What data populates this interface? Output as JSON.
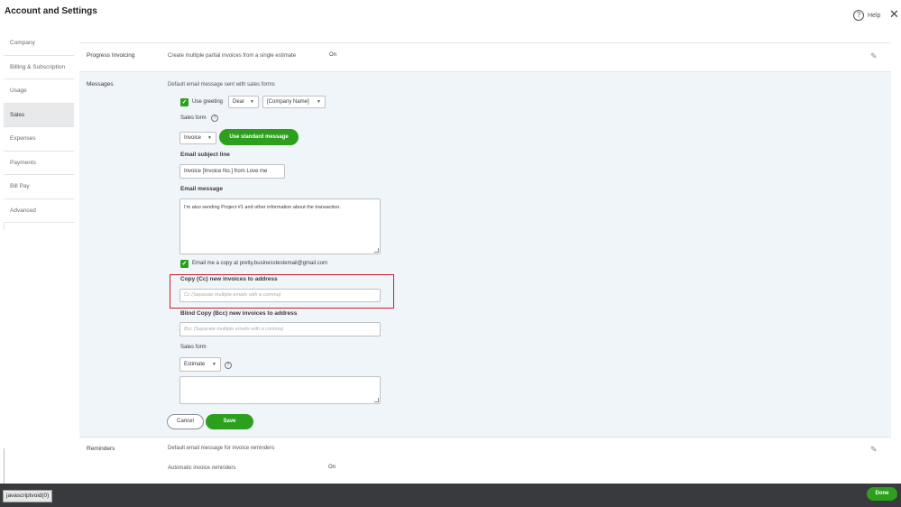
{
  "header": {
    "title": "Account and Settings",
    "help_label": "Help",
    "help_glyph": "?",
    "close_glyph": "✕"
  },
  "sidebar": {
    "items": [
      {
        "label": "Company"
      },
      {
        "label": "Billing & Subscription"
      },
      {
        "label": "Usage"
      },
      {
        "label": "Sales"
      },
      {
        "label": "Expenses"
      },
      {
        "label": "Payments"
      },
      {
        "label": "Bill Pay"
      },
      {
        "label": "Advanced"
      }
    ],
    "active": "Sales"
  },
  "progress_invoicing": {
    "label": "Progress Invoicing",
    "description": "Create multiple partial invoices from a single estimate",
    "value": "On"
  },
  "messages": {
    "label": "Messages",
    "description": "Default email message sent with sales forms",
    "use_greeting_label": "Use greeting",
    "greeting_value": "Dear",
    "greeting_name_value": "[Company Name]",
    "sales_form_label": "Sales form",
    "sales_form_value": "Invoice",
    "use_standard_label": "Use standard message",
    "email_subject_label": "Email subject line",
    "email_subject_value": "Invoice [Invoice No.] from Love me",
    "email_message_label": "Email message",
    "email_message_value": "I'm also sending Project #1 and other information about the transaction.",
    "copy_label": "Email me a copy at pretty.businesstestemail@gmail.com",
    "cc_label": "Copy (Cc) new invoices to address",
    "cc_placeholder": "Cc (Separate multiple emails with a comma)",
    "bcc_label": "Blind Copy (Bcc) new invoices to address",
    "bcc_placeholder": "Bcc (Separate multiple emails with a comma)",
    "sales_form2_label": "Sales form",
    "sales_form2_value": "Estimate",
    "cancel_label": "Cancel",
    "save_label": "Save"
  },
  "reminders": {
    "label": "Reminders",
    "description": "Default email message for invoice reminders",
    "auto_label": "Automatic invoice reminders",
    "auto_value": "On"
  },
  "footer": {
    "status_url": "javascriptvoid(0)",
    "done_label": "Done"
  },
  "icons": {
    "pencil": "✎",
    "check": "✓",
    "caret": "▼",
    "info": "?"
  },
  "colors": {
    "accent_green": "#2ca01c",
    "highlight_red": "#c6202a",
    "panel_bg": "#f0f5fa",
    "footer_bg": "#393a3d"
  }
}
